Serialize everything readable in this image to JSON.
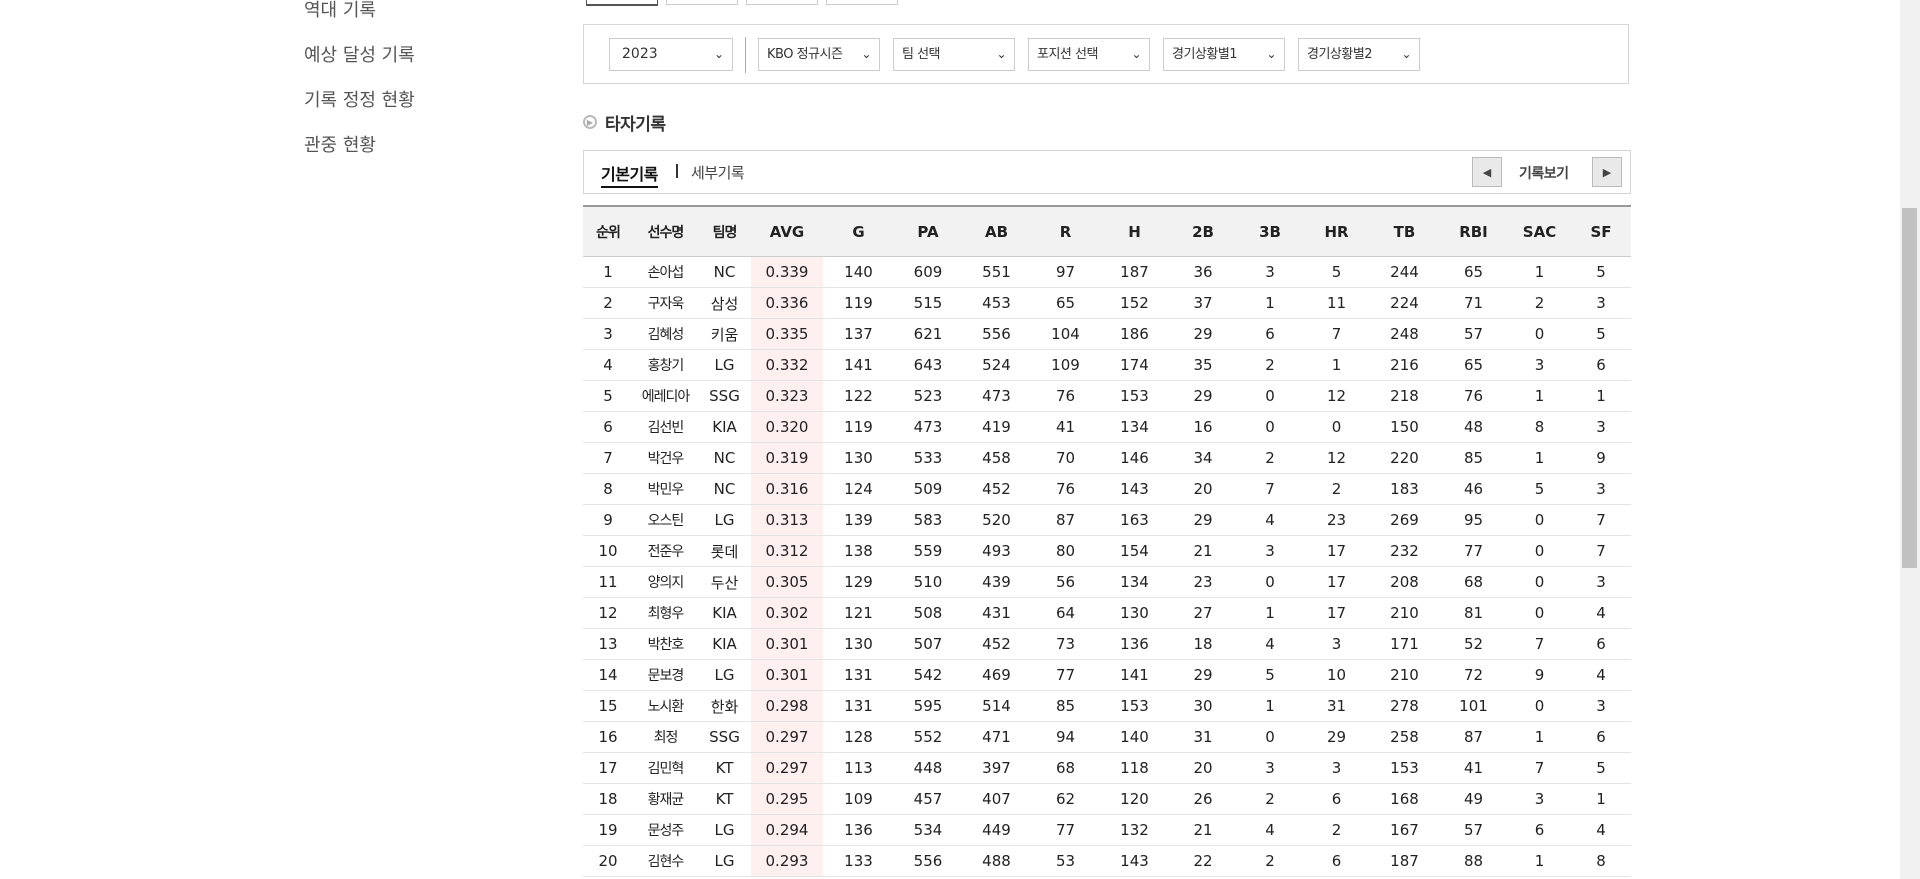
{
  "sidebar": {
    "items": [
      "역대 기록",
      "예상 달성 기록",
      "기록 정정 현황",
      "관중 현황"
    ]
  },
  "filters": {
    "season": "2023",
    "series": "KBO 정규시즌",
    "team": "팀 선택",
    "position": "포지션 선택",
    "situation1": "경기상황별1",
    "situation2": "경기상황별2"
  },
  "section": {
    "title": "타자기록"
  },
  "subtabs": {
    "basic": "기본기록",
    "detail": "세부기록",
    "view_label": "기록보기"
  },
  "icons": {
    "prev": "chevron-left-icon",
    "next": "chevron-right-icon",
    "section": "circle-play-icon",
    "dropdown": "chevron-down-icon"
  },
  "colors": {
    "avg_highlight": "#fdf0ef",
    "header_bg": "#f2f2f2"
  },
  "table": {
    "headers": [
      "순위",
      "선수명",
      "팀명",
      "AVG",
      "G",
      "PA",
      "AB",
      "R",
      "H",
      "2B",
      "3B",
      "HR",
      "TB",
      "RBI",
      "SAC",
      "SF"
    ],
    "rows": [
      [
        "1",
        "손아섭",
        "NC",
        "0.339",
        "140",
        "609",
        "551",
        "97",
        "187",
        "36",
        "3",
        "5",
        "244",
        "65",
        "1",
        "5"
      ],
      [
        "2",
        "구자욱",
        "삼성",
        "0.336",
        "119",
        "515",
        "453",
        "65",
        "152",
        "37",
        "1",
        "11",
        "224",
        "71",
        "2",
        "3"
      ],
      [
        "3",
        "김혜성",
        "키움",
        "0.335",
        "137",
        "621",
        "556",
        "104",
        "186",
        "29",
        "6",
        "7",
        "248",
        "57",
        "0",
        "5"
      ],
      [
        "4",
        "홍창기",
        "LG",
        "0.332",
        "141",
        "643",
        "524",
        "109",
        "174",
        "35",
        "2",
        "1",
        "216",
        "65",
        "3",
        "6"
      ],
      [
        "5",
        "에레디아",
        "SSG",
        "0.323",
        "122",
        "523",
        "473",
        "76",
        "153",
        "29",
        "0",
        "12",
        "218",
        "76",
        "1",
        "1"
      ],
      [
        "6",
        "김선빈",
        "KIA",
        "0.320",
        "119",
        "473",
        "419",
        "41",
        "134",
        "16",
        "0",
        "0",
        "150",
        "48",
        "8",
        "3"
      ],
      [
        "7",
        "박건우",
        "NC",
        "0.319",
        "130",
        "533",
        "458",
        "70",
        "146",
        "34",
        "2",
        "12",
        "220",
        "85",
        "1",
        "9"
      ],
      [
        "8",
        "박민우",
        "NC",
        "0.316",
        "124",
        "509",
        "452",
        "76",
        "143",
        "20",
        "7",
        "2",
        "183",
        "46",
        "5",
        "3"
      ],
      [
        "9",
        "오스틴",
        "LG",
        "0.313",
        "139",
        "583",
        "520",
        "87",
        "163",
        "29",
        "4",
        "23",
        "269",
        "95",
        "0",
        "7"
      ],
      [
        "10",
        "전준우",
        "롯데",
        "0.312",
        "138",
        "559",
        "493",
        "80",
        "154",
        "21",
        "3",
        "17",
        "232",
        "77",
        "0",
        "7"
      ],
      [
        "11",
        "양의지",
        "두산",
        "0.305",
        "129",
        "510",
        "439",
        "56",
        "134",
        "23",
        "0",
        "17",
        "208",
        "68",
        "0",
        "3"
      ],
      [
        "12",
        "최형우",
        "KIA",
        "0.302",
        "121",
        "508",
        "431",
        "64",
        "130",
        "27",
        "1",
        "17",
        "210",
        "81",
        "0",
        "4"
      ],
      [
        "13",
        "박찬호",
        "KIA",
        "0.301",
        "130",
        "507",
        "452",
        "73",
        "136",
        "18",
        "4",
        "3",
        "171",
        "52",
        "7",
        "6"
      ],
      [
        "14",
        "문보경",
        "LG",
        "0.301",
        "131",
        "542",
        "469",
        "77",
        "141",
        "29",
        "5",
        "10",
        "210",
        "72",
        "9",
        "4"
      ],
      [
        "15",
        "노시환",
        "한화",
        "0.298",
        "131",
        "595",
        "514",
        "85",
        "153",
        "30",
        "1",
        "31",
        "278",
        "101",
        "0",
        "3"
      ],
      [
        "16",
        "최정",
        "SSG",
        "0.297",
        "128",
        "552",
        "471",
        "94",
        "140",
        "31",
        "0",
        "29",
        "258",
        "87",
        "1",
        "6"
      ],
      [
        "17",
        "김민혁",
        "KT",
        "0.297",
        "113",
        "448",
        "397",
        "68",
        "118",
        "20",
        "3",
        "3",
        "153",
        "41",
        "7",
        "5"
      ],
      [
        "18",
        "황재균",
        "KT",
        "0.295",
        "109",
        "457",
        "407",
        "62",
        "120",
        "26",
        "2",
        "6",
        "168",
        "49",
        "3",
        "1"
      ],
      [
        "19",
        "문성주",
        "LG",
        "0.294",
        "136",
        "534",
        "449",
        "77",
        "132",
        "21",
        "4",
        "2",
        "167",
        "57",
        "6",
        "4"
      ],
      [
        "20",
        "김현수",
        "LG",
        "0.293",
        "133",
        "556",
        "488",
        "53",
        "143",
        "22",
        "2",
        "6",
        "187",
        "88",
        "1",
        "8"
      ]
    ]
  }
}
